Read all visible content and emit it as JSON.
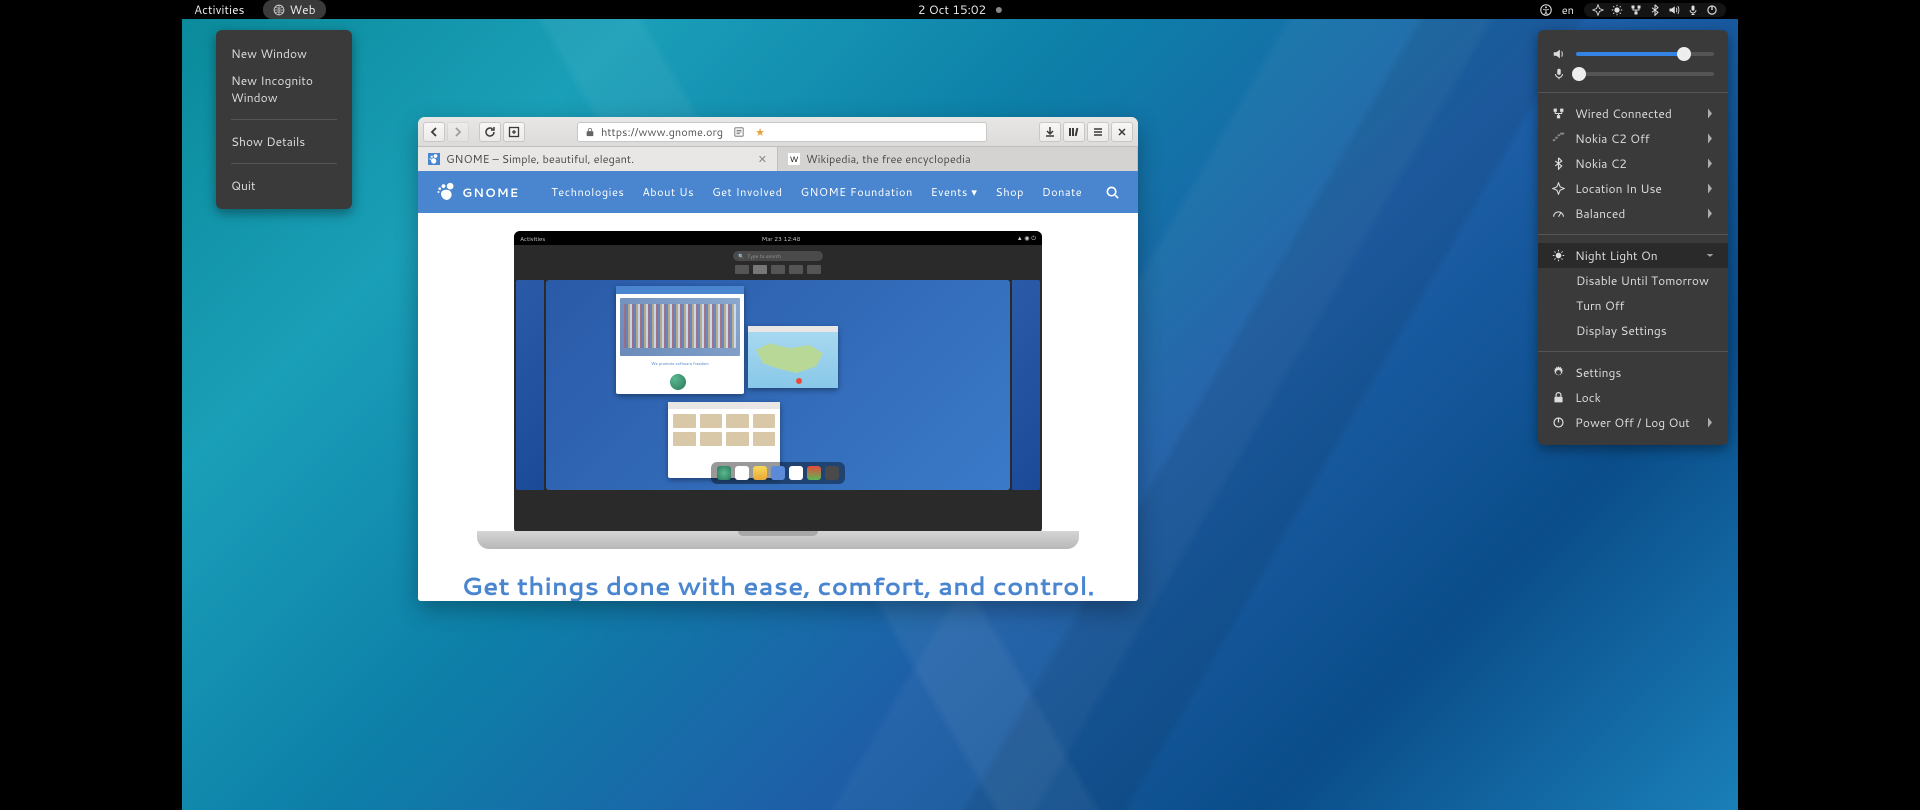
{
  "topbar": {
    "activities": "Activities",
    "app_name": "Web",
    "clock": "2 Oct  15:02",
    "lang": "en"
  },
  "appmenu": {
    "new_window": "New Window",
    "new_incognito": "New Incognito Window",
    "show_details": "Show Details",
    "quit": "Quit"
  },
  "sysmenu": {
    "volume_pct": 78,
    "mic_pct": 2,
    "wired": "Wired Connected",
    "wifi": "Nokia C2 Off",
    "bt": "Nokia C2",
    "location": "Location In Use",
    "power_profile": "Balanced",
    "nightlight": "Night Light On",
    "nightlight_disable": "Disable Until Tomorrow",
    "nightlight_off": "Turn Off",
    "nightlight_display": "Display Settings",
    "settings": "Settings",
    "lock": "Lock",
    "poweroff": "Power Off / Log Out"
  },
  "browser": {
    "url": "https://www.gnome.org",
    "tabs": [
      {
        "title": "GNOME – Simple, beautiful, elegant.",
        "active": true
      },
      {
        "title": "Wikipedia, the free encyclopedia",
        "active": false
      }
    ],
    "page": {
      "brand": "GNOME",
      "nav": {
        "tech": "Technologies",
        "about": "About Us",
        "involved": "Get Involved",
        "foundation": "GNOME Foundation",
        "events": "Events",
        "shop": "Shop",
        "donate": "Donate"
      },
      "shell": {
        "activities": "Activities",
        "clock": "Mar 23  12:48",
        "search": "Type to search",
        "win1_caption": "We promote software freedom"
      },
      "tagline": "Get things done with ease, comfort, and control."
    }
  }
}
